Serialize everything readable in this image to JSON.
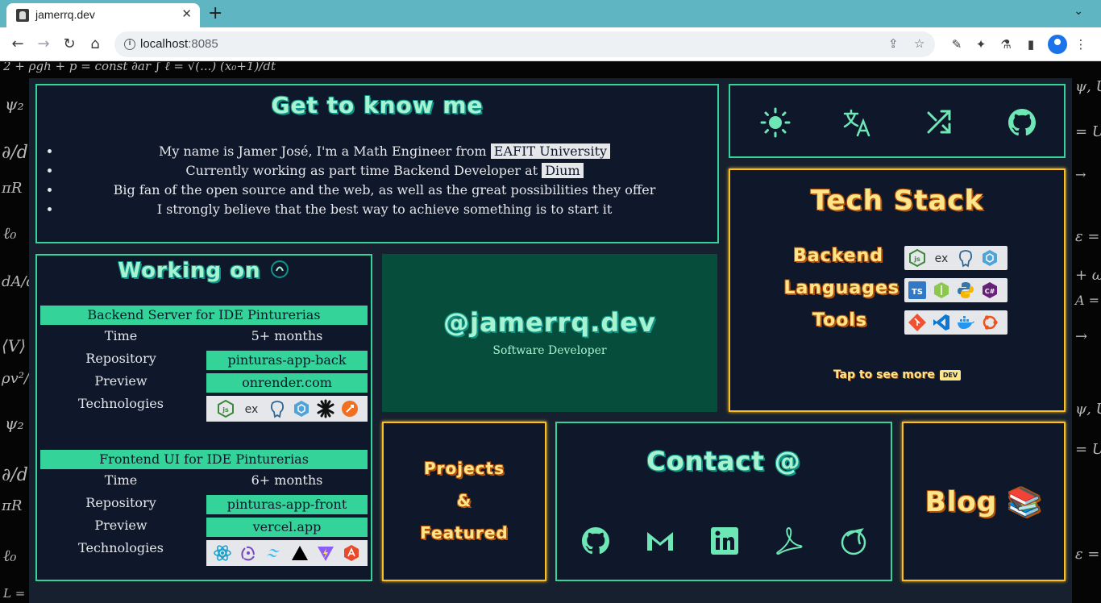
{
  "browser": {
    "tab_title": "jamerrq.dev",
    "tab_close": "✕",
    "new_tab": "+",
    "url_host": "localhost",
    "url_port": ":8085"
  },
  "about": {
    "title": "Get to know me",
    "items": [
      {
        "text": "My name is Jamer José, I'm a Math Engineer from ",
        "highlight": "EAFIT University"
      },
      {
        "text": "Currently working as part time Backend Developer at ",
        "highlight": "Dium"
      },
      {
        "text": "Big fan of the open source and the web, as well as the great possibilities they offer",
        "highlight": ""
      },
      {
        "text": "I strongly believe that the best way to achieve something is to start it",
        "highlight": ""
      }
    ]
  },
  "icon_bar": [
    "sun-icon",
    "translate-icon",
    "shuffle-icon",
    "github-icon"
  ],
  "tech_stack": {
    "title": "Tech Stack",
    "rows": [
      {
        "label": "Backend",
        "icons": [
          "nodejs-icon",
          "express-icon",
          "postgresql-icon",
          "prisma-icon"
        ]
      },
      {
        "label": "Languages",
        "icons": [
          "typescript-icon",
          "nodejs-icon",
          "python-icon",
          "csharp-icon"
        ]
      },
      {
        "label": "Tools",
        "icons": [
          "git-icon",
          "vscode-icon",
          "docker-icon",
          "ubuntu-icon"
        ]
      }
    ],
    "tap_more": "Tap to see more",
    "dev_badge": "DEV"
  },
  "working_on": {
    "title": "Working on",
    "projects": [
      {
        "name": "Backend Server for IDE Pinturerias",
        "time_label": "Time",
        "time": "5+ months",
        "repo_label": "Repository",
        "repo": "pinturas-app-back",
        "preview_label": "Preview",
        "preview": "onrender.com",
        "tech_label": "Technologies",
        "techs": [
          "nodejs-icon",
          "express-icon",
          "postgresql-icon",
          "prisma-icon",
          "openai-icon",
          "swagger-icon"
        ]
      },
      {
        "name": "Frontend UI for IDE Pinturerias",
        "time_label": "Time",
        "time": "6+ months",
        "repo_label": "Repository",
        "repo": "pinturas-app-front",
        "preview_label": "Preview",
        "preview": "vercel.app",
        "tech_label": "Technologies",
        "techs": [
          "react-icon",
          "redux-icon",
          "tailwind-icon",
          "vercel-icon",
          "vite-icon",
          "astro-icon"
        ]
      }
    ]
  },
  "hero": {
    "handle": "@jamerrq.dev",
    "role": "Software Developer"
  },
  "projects_card": {
    "line1": "Projects",
    "line2": "&",
    "line3": "Featured"
  },
  "contact": {
    "title": "Contact @",
    "icons": [
      "github-icon",
      "gmail-icon",
      "linkedin-icon",
      "acrobat-icon",
      "codepen-icon"
    ]
  },
  "blog": {
    "title": "Blog 📚"
  },
  "colors": {
    "teal": "#34d399",
    "gold": "#fbbf24",
    "card_bg": "#0f172a",
    "hero_bg": "#064e3b"
  }
}
